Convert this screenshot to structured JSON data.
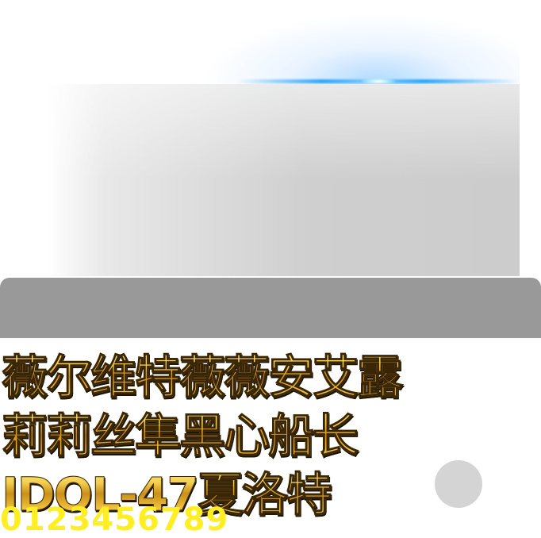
{
  "lines": {
    "line1": "薇尔维特薇薇安艾露",
    "line2": "莉莉丝隼黑心船长",
    "line3": "IDOL-47夏洛特",
    "digits": "0123456789"
  },
  "colors": {
    "background": "#ffffff",
    "flare": "#00a0ff",
    "panel": "#cccccc",
    "bar": "#999999",
    "gold_text": "#e8b92a",
    "digit_text": "#ffee22",
    "circle": "#d4d4d4"
  }
}
